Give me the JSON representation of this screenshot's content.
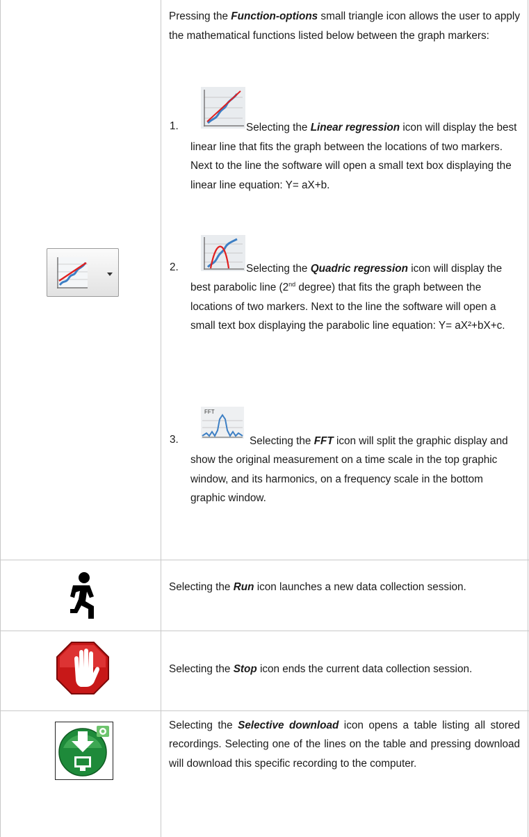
{
  "row1": {
    "intro_pre": "Pressing the ",
    "intro_term": "Function-options",
    "intro_post": " small triangle icon allows the user to apply the mathematical functions listed below between the graph markers:",
    "function_button_icon": "function-options-chart-icon",
    "items": [
      {
        "number": "1.",
        "icon": "linear-regression-icon",
        "pre": "Selecting the ",
        "term": "Linear regression",
        "post": " icon will display the best linear line that fits the graph between the locations of two markers. Next to the line the software will open a small text box displaying the linear line equation: Y= aX+b."
      },
      {
        "number": "2.",
        "icon": "quadric-regression-icon",
        "pre": "Selecting the ",
        "term": "Quadric regression",
        "post_a": " icon will display the best parabolic line (2",
        "sup": "nd",
        "post_b": " degree) that fits the graph between the locations of two markers. Next to the line the software will open a small text box displaying the parabolic line equation: Y= aX²+bX+c."
      },
      {
        "number": "3.",
        "icon": "fft-icon",
        "icon_label": "FFT",
        "pre": "Selecting the ",
        "term": "FFT",
        "post": " icon will split the graphic display and show the original measurement on a time scale in the top graphic window, and its harmonics, on a frequency scale in the bottom graphic window."
      }
    ]
  },
  "row2": {
    "icon": "run-icon",
    "pre": "Selecting the ",
    "term": "Run",
    "post": " icon launches a new data collection session."
  },
  "row3": {
    "icon": "stop-hand-icon",
    "pre": "Selecting the ",
    "term": "Stop",
    "post": " icon ends the current data collection session."
  },
  "row4": {
    "icon": "selective-download-icon",
    "pre": "Selecting the ",
    "term": "Selective download",
    "post": " icon opens a table listing all stored recordings. Selecting one of the lines on the table and pressing download will download this specific recording to the computer."
  }
}
